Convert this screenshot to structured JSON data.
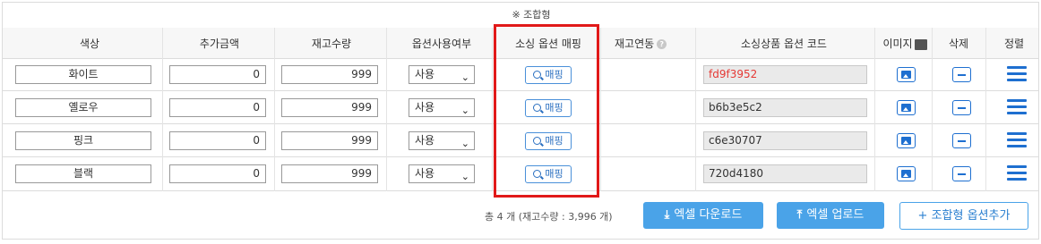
{
  "caption": "※ 조합형",
  "headers": {
    "color": "색상",
    "extra_price": "추가금액",
    "stock": "재고수량",
    "option_use": "옵션사용여부",
    "sourcing_map": "소싱 옵션 매핑",
    "stock_link": "재고연동",
    "sourcing_code": "소싱상품 옵션 코드",
    "image": "이미지",
    "delete": "삭제",
    "sort": "정렬"
  },
  "rows": [
    {
      "color": "화이트",
      "price": "0",
      "stock": "999",
      "use": "사용",
      "map": "매핑",
      "code": "fd9f3952",
      "code_color": "#e53935"
    },
    {
      "color": "옐로우",
      "price": "0",
      "stock": "999",
      "use": "사용",
      "map": "매핑",
      "code": "b6b3e5c2",
      "code_color": "#333333"
    },
    {
      "color": "핑크",
      "price": "0",
      "stock": "999",
      "use": "사용",
      "map": "매핑",
      "code": "c6e30707",
      "code_color": "#333333"
    },
    {
      "color": "블랙",
      "price": "0",
      "stock": "999",
      "use": "사용",
      "map": "매핑",
      "code": "720d4180",
      "code_color": "#333333"
    }
  ],
  "footer": {
    "total": "총 4 개  (재고수량 : 3,996 개)",
    "excel_download": "엑셀 다운로드",
    "excel_upload": "엑셀 업로드",
    "add_option": "+ 조합형 옵션추가"
  },
  "colors": {
    "accent": "#4aa3e8",
    "highlight_box": "#e11919",
    "button_blue": "#1e6fd0"
  }
}
